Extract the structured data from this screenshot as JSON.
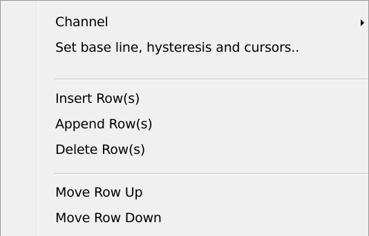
{
  "menu": {
    "items": [
      {
        "label": "Channel",
        "has_submenu": true
      },
      {
        "label": "Set base line, hysteresis and cursors.."
      },
      {
        "label": "Insert Row(s)"
      },
      {
        "label": "Append Row(s)"
      },
      {
        "label": "Delete Row(s)"
      },
      {
        "label": "Move Row Up"
      },
      {
        "label": "Move Row Down"
      }
    ],
    "icons": {
      "submenu_arrow": "chevron-right-icon"
    }
  }
}
